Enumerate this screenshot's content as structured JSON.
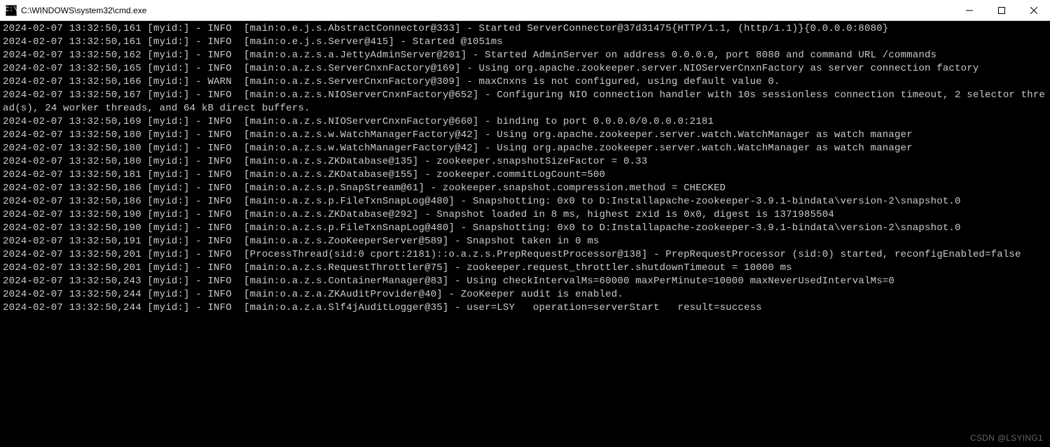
{
  "window": {
    "title": "C:\\WINDOWS\\system32\\cmd.exe"
  },
  "watermark": "CSDN @LSYING1",
  "log_lines": [
    "2024-02-07 13:32:50,161 [myid:] - INFO  [main:o.e.j.s.AbstractConnector@333] - Started ServerConnector@37d31475{HTTP/1.1, (http/1.1)}{0.0.0.0:8080}",
    "2024-02-07 13:32:50,161 [myid:] - INFO  [main:o.e.j.s.Server@415] - Started @1051ms",
    "2024-02-07 13:32:50,162 [myid:] - INFO  [main:o.a.z.s.a.JettyAdminServer@201] - Started AdminServer on address 0.0.0.0, port 8080 and command URL /commands",
    "2024-02-07 13:32:50,165 [myid:] - INFO  [main:o.a.z.s.ServerCnxnFactory@169] - Using org.apache.zookeeper.server.NIOServerCnxnFactory as server connection factory",
    "2024-02-07 13:32:50,166 [myid:] - WARN  [main:o.a.z.s.ServerCnxnFactory@309] - maxCnxns is not configured, using default value 0.",
    "2024-02-07 13:32:50,167 [myid:] - INFO  [main:o.a.z.s.NIOServerCnxnFactory@652] - Configuring NIO connection handler with 10s sessionless connection timeout, 2 selector thread(s), 24 worker threads, and 64 kB direct buffers.",
    "2024-02-07 13:32:50,169 [myid:] - INFO  [main:o.a.z.s.NIOServerCnxnFactory@660] - binding to port 0.0.0.0/0.0.0.0:2181",
    "2024-02-07 13:32:50,180 [myid:] - INFO  [main:o.a.z.s.w.WatchManagerFactory@42] - Using org.apache.zookeeper.server.watch.WatchManager as watch manager",
    "2024-02-07 13:32:50,180 [myid:] - INFO  [main:o.a.z.s.w.WatchManagerFactory@42] - Using org.apache.zookeeper.server.watch.WatchManager as watch manager",
    "2024-02-07 13:32:50,180 [myid:] - INFO  [main:o.a.z.s.ZKDatabase@135] - zookeeper.snapshotSizeFactor = 0.33",
    "2024-02-07 13:32:50,181 [myid:] - INFO  [main:o.a.z.s.ZKDatabase@155] - zookeeper.commitLogCount=500",
    "2024-02-07 13:32:50,186 [myid:] - INFO  [main:o.a.z.s.p.SnapStream@61] - zookeeper.snapshot.compression.method = CHECKED",
    "2024-02-07 13:32:50,186 [myid:] - INFO  [main:o.a.z.s.p.FileTxnSnapLog@480] - Snapshotting: 0x0 to D:Installapache-zookeeper-3.9.1-bindata\\version-2\\snapshot.0",
    "2024-02-07 13:32:50,190 [myid:] - INFO  [main:o.a.z.s.ZKDatabase@292] - Snapshot loaded in 8 ms, highest zxid is 0x0, digest is 1371985504",
    "2024-02-07 13:32:50,190 [myid:] - INFO  [main:o.a.z.s.p.FileTxnSnapLog@480] - Snapshotting: 0x0 to D:Installapache-zookeeper-3.9.1-bindata\\version-2\\snapshot.0",
    "2024-02-07 13:32:50,191 [myid:] - INFO  [main:o.a.z.s.ZooKeeperServer@589] - Snapshot taken in 0 ms",
    "2024-02-07 13:32:50,201 [myid:] - INFO  [ProcessThread(sid:0 cport:2181)::o.a.z.s.PrepRequestProcessor@138] - PrepRequestProcessor (sid:0) started, reconfigEnabled=false",
    "2024-02-07 13:32:50,201 [myid:] - INFO  [main:o.a.z.s.RequestThrottler@75] - zookeeper.request_throttler.shutdownTimeout = 10000 ms",
    "2024-02-07 13:32:50,243 [myid:] - INFO  [main:o.a.z.s.ContainerManager@83] - Using checkIntervalMs=60000 maxPerMinute=10000 maxNeverUsedIntervalMs=0",
    "2024-02-07 13:32:50,244 [myid:] - INFO  [main:o.a.z.a.ZKAuditProvider@40] - ZooKeeper audit is enabled.",
    "2024-02-07 13:32:50,244 [myid:] - INFO  [main:o.a.z.a.Slf4jAuditLogger@35] - user=LSY   operation=serverStart   result=success"
  ]
}
